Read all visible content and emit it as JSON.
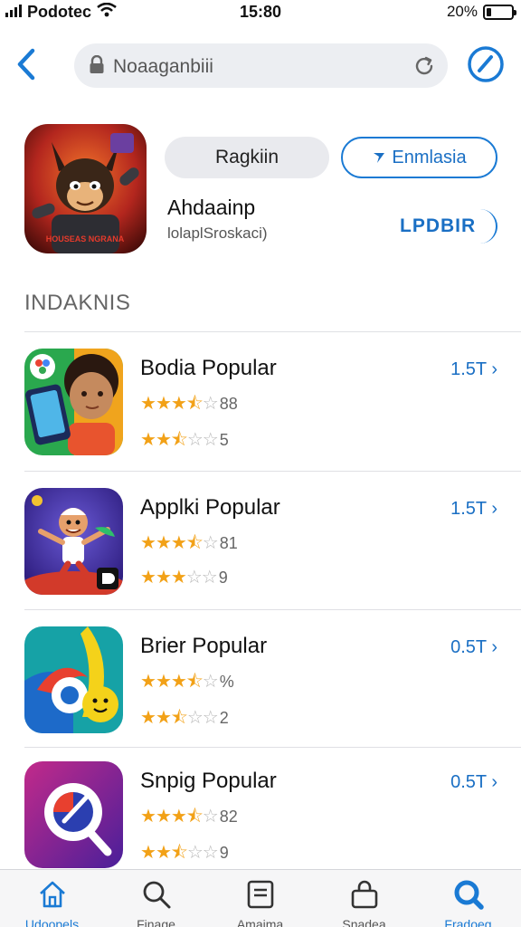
{
  "status_bar": {
    "carrier": "Podotec",
    "time": "15:80",
    "battery_percent": "20%",
    "battery_level": 0.2
  },
  "address_bar": {
    "url": "Noaaganbiii",
    "lock_icon": "lock-icon",
    "reload_icon": "reload-icon"
  },
  "nav": {
    "back_icon": "chevron-left-icon",
    "compass_icon": "compass-icon"
  },
  "featured": {
    "icon": "game-character-icon",
    "icon_text": "HOUSEAS NGRANA",
    "gray_button": "Ragkiin",
    "blue_button": "Enmlasia",
    "title": "Ahdaainp",
    "subtitle": "lolaplSroskaci)",
    "load_button": "LPDBIR"
  },
  "section": {
    "title": "INDAKNIS"
  },
  "apps": [
    {
      "title": "Bodia Popular",
      "price": "1.5T",
      "rating1": 3.5,
      "count1": "88",
      "rating2": 2.5,
      "count2": "5",
      "icon": "girl-with-phone-icon"
    },
    {
      "title": "Applki Popular",
      "price": "1.5T",
      "rating1": 3.5,
      "count1": "81",
      "rating2": 3,
      "count2": "9",
      "icon": "cartoon-character-icon"
    },
    {
      "title": "Brier Popular",
      "price": "0.5T",
      "rating1": 3.5,
      "count1": "%",
      "rating2": 2.5,
      "count2": "2",
      "icon": "smiley-swirl-icon"
    },
    {
      "title": "Snpig Popular",
      "price": "0.5T",
      "rating1": 3.5,
      "count1": "82",
      "rating2": 2.5,
      "count2": "9",
      "icon": "search-compass-app-icon"
    }
  ],
  "tabs": [
    {
      "label": "Udoopels",
      "icon": "home-icon"
    },
    {
      "label": "Finage",
      "icon": "search-icon"
    },
    {
      "label": "Amaima",
      "icon": "document-icon"
    },
    {
      "label": "Snadea",
      "icon": "bag-icon"
    },
    {
      "label": "Fradoeg",
      "icon": "search-icon",
      "active": true
    }
  ],
  "colors": {
    "accent": "#1a7ad4",
    "star": "#f2a117",
    "url_bar_bg": "#eceef2"
  }
}
